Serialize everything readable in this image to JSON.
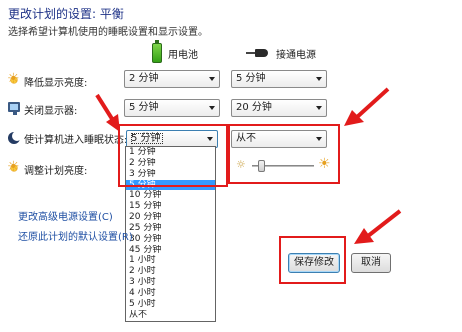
{
  "header": {
    "title": "更改计划的设置: 平衡",
    "subtitle": "选择希望计算机使用的睡眠设置和显示设置。"
  },
  "columns": {
    "battery": "用电池",
    "plugged_in": "接通电源"
  },
  "rows": [
    {
      "icon": "sun-icon",
      "label": "降低显示亮度:",
      "battery": "2 分钟",
      "plugged": "5 分钟"
    },
    {
      "icon": "monitor-icon",
      "label": "关闭显示器:",
      "battery": "5 分钟",
      "plugged": "20 分钟"
    },
    {
      "icon": "moon-icon",
      "label": "使计算机进入睡眠状态:",
      "battery": "5 分钟",
      "plugged": "从不"
    },
    {
      "icon": "sun-icon",
      "label": "调整计划亮度:"
    }
  ],
  "dropdown": {
    "selected_index": 3,
    "options": [
      "1 分钟",
      "2 分钟",
      "3 分钟",
      "5 分钟",
      "10 分钟",
      "15 分钟",
      "20 分钟",
      "25 分钟",
      "30 分钟",
      "45 分钟",
      "1 小时",
      "2 小时",
      "3 小时",
      "4 小时",
      "5 小时",
      "从不"
    ]
  },
  "brightness": {
    "plugged_level": 0.1
  },
  "links": {
    "advanced": "更改高级电源设置(C)",
    "restore": "还原此计划的默认设置(R)"
  },
  "buttons": {
    "save": "保存修改",
    "cancel": "取消"
  },
  "annotation_color": "#e21b1b"
}
